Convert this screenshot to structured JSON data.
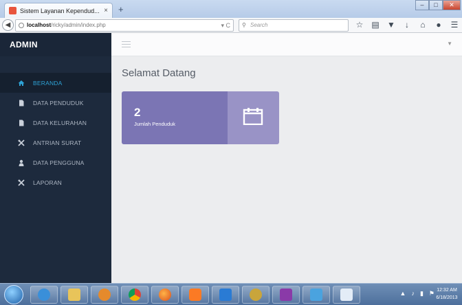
{
  "browser": {
    "tab_title": "Sistem Layanan Kependud...",
    "tab_close": "×",
    "new_tab": "+",
    "url_host": "localhost",
    "url_path": "/ricky/admin/index.php",
    "search_placeholder": "Search",
    "window_buttons": [
      "–",
      "□",
      "✕"
    ]
  },
  "sidebar": {
    "brand": "ADMIN",
    "items": [
      {
        "label": "BERANDA",
        "icon": "home-icon",
        "active": true
      },
      {
        "label": "DATA PENDUDUK",
        "icon": "document-icon",
        "active": false
      },
      {
        "label": "DATA KELURAHAN",
        "icon": "document-icon",
        "active": false
      },
      {
        "label": "ANTRIAN SURAT",
        "icon": "tools-icon",
        "active": false
      },
      {
        "label": "DATA PENGGUNA",
        "icon": "user-icon",
        "active": false
      },
      {
        "label": "LAPORAN",
        "icon": "tools-icon",
        "active": false
      }
    ]
  },
  "main": {
    "title": "Selamat Datang",
    "card": {
      "count": "2",
      "label": "Jumlah Penduduk",
      "icon": "calendar-icon"
    }
  },
  "taskbar": {
    "time": "12:32 AM",
    "date": "6/18/2013"
  },
  "colors": {
    "sidebar_bg": "#1d2a3d",
    "active_text": "#2ea3d7",
    "card_primary": "#7b75b4",
    "card_secondary": "#9993c6"
  }
}
